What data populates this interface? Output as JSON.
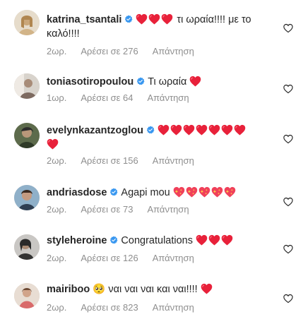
{
  "comments": [
    {
      "username": "katrina_tsantali",
      "text": "τι ωραία!!!! με το καλό!!!!",
      "time": "2ωρ.",
      "likes": "Αρέσει σε 276",
      "reply": "Απάντηση",
      "verified": true,
      "prefix_hearts": 3,
      "avatar_colors": [
        "#d9c9a8",
        "#b99565"
      ]
    },
    {
      "username": "toniasotiropoulou",
      "text": "Τι ωραία",
      "time": "1ωρ.",
      "likes": "Αρέσει σε 64",
      "reply": "Απάντηση",
      "verified": true,
      "suffix_hearts": 1,
      "avatar_colors": [
        "#c8c2bc",
        "#8a7a6f"
      ]
    },
    {
      "username": "evelynkazantzoglou",
      "text": "",
      "time": "2ωρ.",
      "likes": "Αρέσει σε 156",
      "reply": "Απάντηση",
      "verified": true,
      "prefix_hearts": 7,
      "second_line_hearts": 1,
      "avatar_colors": [
        "#4a5a3f",
        "#b3a28a"
      ]
    },
    {
      "username": "andriasdose",
      "text": "Agapi mou",
      "time": "2ωρ.",
      "likes": "Αρέσει σε 73",
      "reply": "Απάντηση",
      "verified": true,
      "suffix_sparkle_hearts": 5,
      "avatar_colors": [
        "#3d4a5a",
        "#9eb0c2"
      ]
    },
    {
      "username": "styleheroine",
      "text": "Congratulations",
      "time": "2ωρ.",
      "likes": "Αρέσει σε 126",
      "reply": "Απάντηση",
      "verified": true,
      "suffix_hearts": 3,
      "avatar_colors": [
        "#b9b7b4",
        "#333333"
      ]
    },
    {
      "username": "mairiboo",
      "text": "ναι ναι ναι και ναι!!!!",
      "time": "2ωρ.",
      "likes": "Αρέσει σε 823",
      "reply": "Απάντηση",
      "verified": false,
      "emoji": "🥺",
      "suffix_hearts": 1,
      "avatar_colors": [
        "#e0a8a0",
        "#a05a50"
      ]
    }
  ],
  "colors": {
    "heart": "#ed1c3a",
    "verified": "#3897f0",
    "meta": "#8e8e8e",
    "like_icon": "#262626"
  },
  "icons": {
    "verified": "verified-badge-icon",
    "heart_emoji": "red-heart-emoji-icon",
    "sparkle_heart": "sparkling-heart-emoji-icon",
    "like": "heart-outline-icon"
  }
}
